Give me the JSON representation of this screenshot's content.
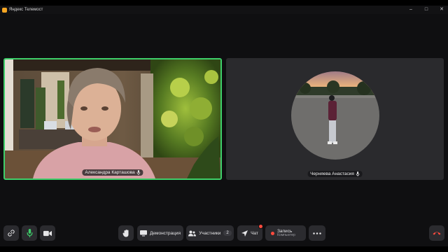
{
  "window": {
    "title": "Яндекс Телемост",
    "controls": [
      "minimize",
      "maximize",
      "close"
    ]
  },
  "participants": [
    {
      "name": "Александра Карташова",
      "active_speaker": true,
      "video": true
    },
    {
      "name": "Черняева Анастасия",
      "active_speaker": false,
      "video": false
    }
  ],
  "toolbar": {
    "left": [
      {
        "icon": "link-icon"
      },
      {
        "icon": "microphone-icon"
      },
      {
        "icon": "camera-icon"
      }
    ],
    "raise_hand": {
      "icon": "hand-icon"
    },
    "demo": {
      "label": "Демонстрация",
      "icon": "screen-share-icon"
    },
    "participants": {
      "label": "Участники",
      "count": "2",
      "icon": "people-icon"
    },
    "chat": {
      "label": "Чат",
      "icon": "send-icon",
      "has_notification": true
    },
    "record": {
      "label": "Запись",
      "sublabel": "Компьютер",
      "icon": "record-dot-icon"
    },
    "more": {
      "icon": "more-icon"
    },
    "hangup": {
      "icon": "hangup-icon"
    }
  },
  "colors": {
    "active_border": "#3ecf6a",
    "mic_active": "#3ecf6a",
    "record_red": "#ff4b3e",
    "hangup_red": "#ff4b3e"
  }
}
